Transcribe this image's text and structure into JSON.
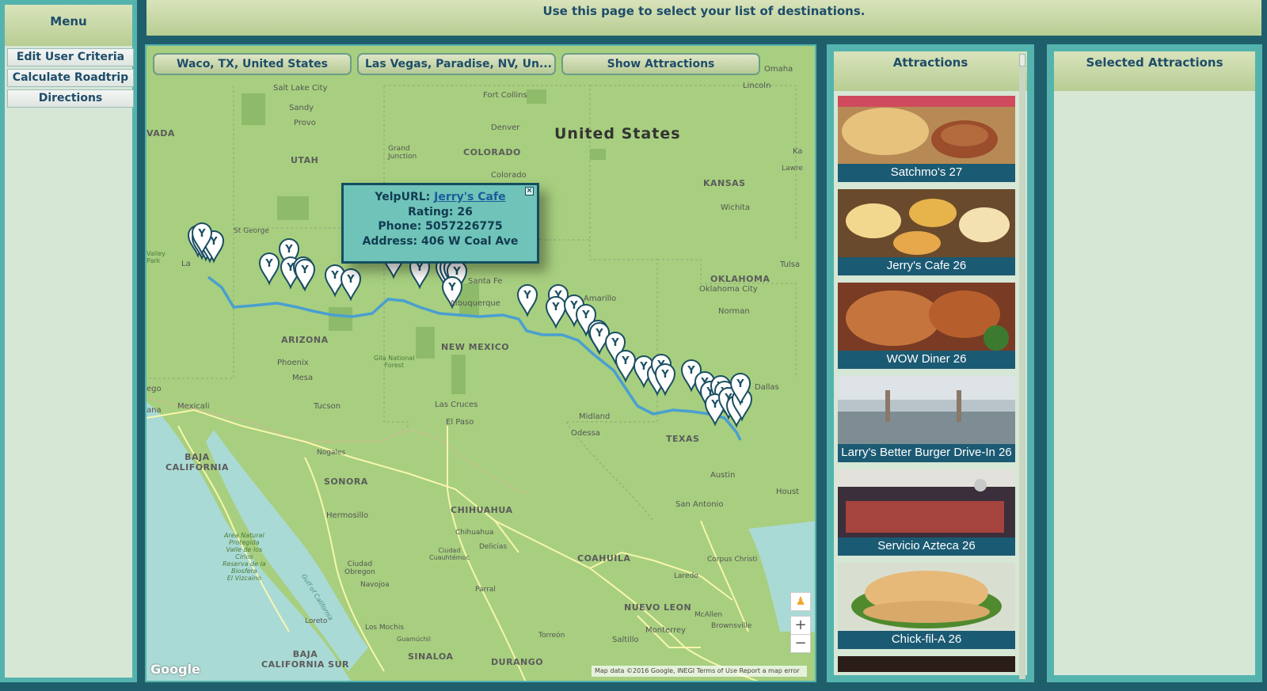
{
  "menu": {
    "title": "Menu",
    "items": [
      {
        "label": "Edit User Criteria"
      },
      {
        "label": "Calculate Roadtrip"
      },
      {
        "label": "Directions"
      }
    ]
  },
  "header": {
    "text": "Use this page to select your list of destinations."
  },
  "map": {
    "origin_button": "Waco, TX, United States",
    "destination_button": "Las Vegas, Paradise, NV, Un...",
    "show_button": "Show Attractions",
    "labels": {
      "country": "United States",
      "utah": "UTAH",
      "colorado": "COLORADO",
      "kansas": "KANSAS",
      "oklahoma": "OKLAHOMA",
      "arizona": "ARIZONA",
      "new_mexico": "NEW MEXICO",
      "texas": "TEXAS",
      "baja_california": "BAJA\nCALIFORNIA",
      "sonora": "SONORA",
      "chihuahua": "CHIHUAHUA",
      "coahuila": "COAHUILA",
      "nuevo_leon": "NUEVO LEON",
      "baja_california_sur": "BAJA\nCALIFORNIA SUR",
      "sinaloa": "SINALOA",
      "durango": "DURANGO",
      "salt_lake_city": "Salt Lake City",
      "sandy": "Sandy",
      "provo": "Provo",
      "fort_collins": "Fort Collins",
      "denver": "Denver",
      "grand_junction": "Grand\nJunction",
      "colorado_springs": "Colorado",
      "st_george": "St George",
      "wichita": "Wichita",
      "lincoln": "Lincoln",
      "omaha": "Omaha",
      "tulsa": "Tulsa",
      "oklahoma_city": "Oklahoma City",
      "norman": "Norman",
      "amarillo": "Amarillo",
      "phoenix": "Phoenix",
      "mesa": "Mesa",
      "tucson": "Tucson",
      "mexicali": "Mexicali",
      "las_cruces": "Las Cruces",
      "el_paso": "El Paso",
      "midland": "Midland",
      "odessa": "Odessa",
      "dallas": "Dallas",
      "austin": "Austin",
      "san_antonio": "San Antonio",
      "nogales": "Nogales",
      "hermosillo": "Hermosillo",
      "chihuahua_city": "Chihuahua",
      "ciudad_obregon": "Ciudad\nObregon",
      "navojoa": "Navojoa",
      "ciudad_cuauhtemoc": "Ciudad\nCuauhtémoc",
      "delicias": "Delicias",
      "parral": "Parral",
      "monterrey": "Monterrey",
      "saltillo": "Saltillo",
      "torreon": "Torreón",
      "los_mochis": "Los Mochis",
      "guamuchil": "Guamúchil",
      "loreto": "Loreto",
      "laredo": "Laredo",
      "corpus_christi": "Corpus Christi",
      "mcallen": "McAllen",
      "brownsville": "Brownsville",
      "gulf_of_california": "Gulf of California",
      "gila": "Gila National\nForest",
      "area_natural": "Area Natural\nProtegida\nValle de los\nCirios\nReserva de la\nBiosfera\nEl Vizcaino",
      "albuquerque": "Albuquerque",
      "santa_fe": "Santa Fe",
      "vada": "VADA",
      "ego": "ego",
      "ana": "ana",
      "houst": "Houst",
      "lawre": "Lawre",
      "ka": "Ka",
      "valley_park": "Valley\nPark",
      "las": "La"
    },
    "popup": {
      "yelp_label": "YelpURL:",
      "yelp_link": "Jerry's Cafe",
      "rating": "Rating: 26",
      "phone": "Phone: 5057226775",
      "address": "Address: 406 W Coal Ave",
      "close": "×"
    },
    "zoom_in": "+",
    "zoom_out": "−",
    "google": "Google",
    "footer": "Map data ©2016 Google, INEGI   Terms of Use   Report a map error"
  },
  "attractions": {
    "title": "Attractions",
    "items": [
      {
        "caption": "Satchmo's 27"
      },
      {
        "caption": "Jerry's Cafe 26"
      },
      {
        "caption": "WOW Diner 26"
      },
      {
        "caption": "Larry's Better Burger Drive-In 26"
      },
      {
        "caption": "Servicio Azteca 26"
      },
      {
        "caption": "Chick-fil-A 26"
      }
    ]
  },
  "selected": {
    "title": "Selected Attractions"
  }
}
